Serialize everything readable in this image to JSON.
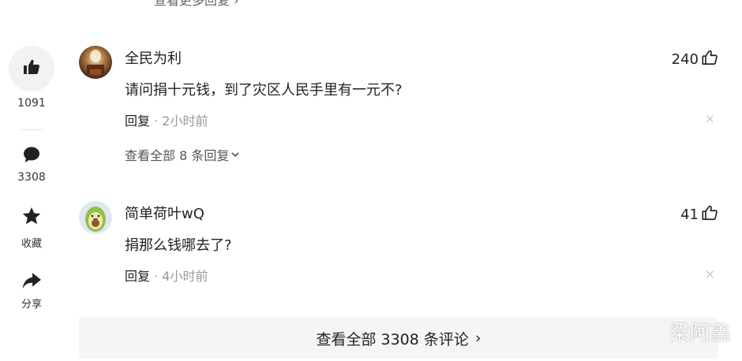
{
  "truncated_top_link": "查看更多回复 ›",
  "rail": {
    "like_count": "1091",
    "comment_count": "3308",
    "favorite_label": "收藏",
    "share_label": "分享"
  },
  "comments": [
    {
      "author": "全民为利",
      "likes": "240",
      "content": "请问捐十元钱，到了灾区人民手里有一元不?",
      "reply_label": "回复",
      "separator": "·",
      "time": "2小时前",
      "close": "×",
      "more_replies": "查看全部 8 条回复",
      "avatar_icon": "portrait-avatar"
    },
    {
      "author": "简单荷叶wQ",
      "likes": "41",
      "content": "捐那么钱哪去了?",
      "reply_label": "回复",
      "separator": "·",
      "time": "4小时前",
      "close": "×",
      "avatar_icon": "avocado-avatar"
    }
  ],
  "footer": {
    "all_comments_label": "查看全部 3308 条评论",
    "chevron": "›"
  },
  "watermark": "梁阿鑫",
  "colors": {
    "text": "#222222",
    "muted": "#999999",
    "rail_bg": "#f2f2f2",
    "footer_bg": "#f5f5f5"
  }
}
